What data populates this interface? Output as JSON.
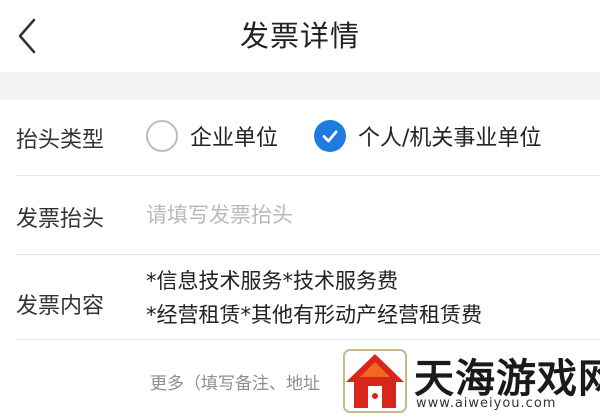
{
  "nav": {
    "title": "发票详情",
    "back_icon": "chevron-left-icon"
  },
  "invoice_type": {
    "label": "抬头类型",
    "options": [
      {
        "label": "企业单位",
        "checked": false
      },
      {
        "label": "个人/机关事业单位",
        "checked": true
      }
    ],
    "accent_color": "#1e7be0"
  },
  "invoice_header": {
    "label": "发票抬头",
    "value": "",
    "placeholder": "请填写发票抬头"
  },
  "invoice_content": {
    "label": "发票内容",
    "lines": [
      "*信息技术服务*技术服务费",
      "*经营租赁*其他有形动产经营租赁费"
    ]
  },
  "more": {
    "text": "更多（填写备注、地址"
  },
  "watermark": {
    "name": "天海游戏网",
    "url": "www.aiweiyou.com"
  }
}
